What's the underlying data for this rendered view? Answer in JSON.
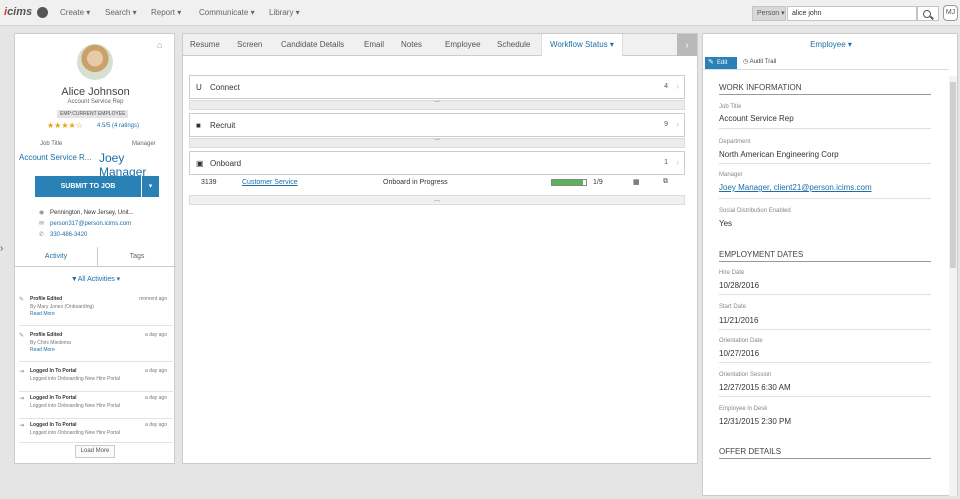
{
  "topnav": {
    "logo_i": "i",
    "logo_rest": "cims",
    "items": [
      "Create ▾",
      "Search ▾",
      "Report ▾",
      "Communicate ▾",
      "Library ▾"
    ],
    "person_filter": "Person ▾",
    "search_value": "alice john",
    "user_initials": "MJ"
  },
  "profile": {
    "name": "Alice Johnson",
    "title": "Account Service Rep",
    "badge": "EMP:CURRENT EMPLOYEE",
    "stars": "★★★★☆",
    "rating": "4.5/5 (4 ratings)",
    "job_title_label": "Job Title",
    "job_title": "Account Service R...",
    "manager_label": "Manager",
    "manager": "Joey Manager",
    "submit_label": "SUBMIT TO JOB",
    "submit_caret": "▾",
    "location": "Pennington, New Jersey, Unit...",
    "email": "person317@person.icims.com",
    "phone": "330-486-3420",
    "tabs": [
      "Activity",
      "Tags"
    ],
    "filter": "▼All Activities ▾",
    "activities": [
      {
        "title": "Profile Edited",
        "when": "moment ago",
        "desc": "By Mary Jones (Onboarding)",
        "more": "Read More",
        "icon": "✎"
      },
      {
        "title": "Profile Edited",
        "when": "a day ago",
        "desc": "By Chris Miedema",
        "more": "Read More",
        "icon": "✎"
      },
      {
        "title": "Logged In To Portal",
        "when": "a day ago",
        "desc": "Logged into Onboarding New Hire Portal",
        "more": "",
        "icon": "⇥"
      },
      {
        "title": "Logged In To Portal",
        "when": "a day ago",
        "desc": "Logged into Onboarding New Hire Portal",
        "more": "",
        "icon": "⇥"
      },
      {
        "title": "Logged In To Portal",
        "when": "a day ago",
        "desc": "Logged into Onboarding New Hire Portal",
        "more": "",
        "icon": "⇥"
      }
    ],
    "load_more": "Load More"
  },
  "main": {
    "tabs": [
      "Resume",
      "Screen",
      "Candidate Details",
      "Email",
      "Notes",
      "Employee",
      "Schedule",
      "Workflow Status ▾"
    ],
    "sections": [
      {
        "label": "Connect",
        "count": "4"
      },
      {
        "label": "Recruit",
        "count": "9"
      },
      {
        "label": "Onboard",
        "count": "1"
      }
    ],
    "onboard_row": {
      "id": "3139",
      "job": "Customer Service",
      "status": "Onboard in Progress",
      "progress_fraction": 0.9,
      "progress": "1/9"
    }
  },
  "employee": {
    "title": "Employee ▾",
    "edit": "Edit",
    "audit": "Audit Trail",
    "work_header": "WORK INFORMATION",
    "job_title_label": "Job Title",
    "job_title": "Account Service Rep",
    "department_label": "Department",
    "department": "North American Engineering Corp",
    "manager_label": "Manager",
    "manager": "Joey Manager, client21@person.icims.com",
    "social_label": "Social Distribution Enabled",
    "social": "Yes",
    "dates_header": "EMPLOYMENT DATES",
    "hire_label": "Hire Date",
    "hire": "10/28/2016",
    "start_label": "Start Date",
    "start": "11/21/2016",
    "orient_label": "Orientation Date",
    "orient": "10/27/2016",
    "session_label": "Orientation Session",
    "session": "12/27/2015 6:30 AM",
    "desk_label": "Employee in Desk",
    "desk": "12/31/2015 2:30 PM",
    "offer_header": "OFFER DETAILS"
  }
}
